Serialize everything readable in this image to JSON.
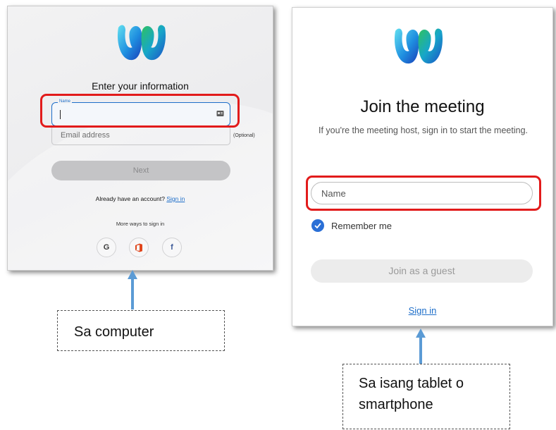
{
  "desktop": {
    "title": "Enter your information",
    "name_field_label": "Name",
    "email_placeholder": "Email address",
    "optional_label": "(Optional)",
    "next_label": "Next",
    "account_prompt": "Already have an account?",
    "sign_in_link": "Sign in",
    "more_ways": "More ways to sign in",
    "social": [
      {
        "icon": "google-icon",
        "glyph": "G"
      },
      {
        "icon": "office-icon",
        "glyph": ""
      },
      {
        "icon": "facebook-icon",
        "glyph": "f"
      }
    ]
  },
  "mobile": {
    "title": "Join the meeting",
    "subtitle": "If you're the meeting host, sign in to start the meeting.",
    "name_placeholder": "Name",
    "remember_me": "Remember me",
    "join_guest_label": "Join as a guest",
    "sign_in_link": "Sign in"
  },
  "captions": {
    "computer": "Sa computer",
    "tablet_line1": "Sa isang tablet o",
    "tablet_line2": "smartphone"
  },
  "colors": {
    "highlight": "#e21b1b",
    "link": "#1d6ec9",
    "arrow": "#5b9bd5",
    "checkbox": "#2a6fd6"
  }
}
